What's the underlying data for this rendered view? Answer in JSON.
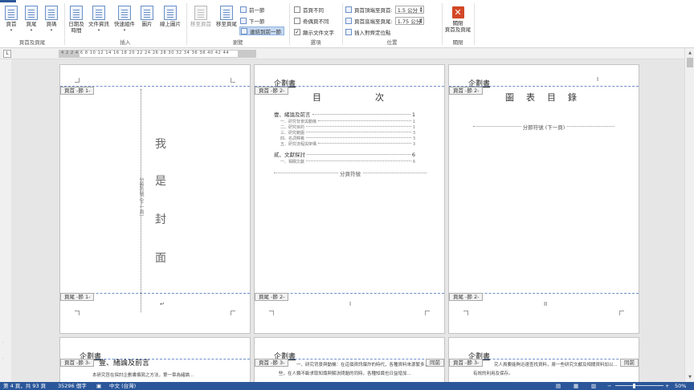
{
  "ribbon": {
    "group_header_footer": {
      "label": "頁首及頁尾",
      "header": "頁首",
      "footer": "頁尾",
      "page_number": "頁碼"
    },
    "group_insert": {
      "label": "插入",
      "date_time": "日期及\n時間",
      "doc_info": "文件資訊",
      "quick_parts": "快速組件",
      "picture": "圖片",
      "online_picture": "線上圖片"
    },
    "group_navigation": {
      "label": "瀏覽",
      "goto_header": "移至頁首",
      "goto_footer": "移至頁尾",
      "previous": "前一節",
      "next": "下一節",
      "link_to_previous": "連結到前一節"
    },
    "group_options": {
      "label": "選項",
      "different_first_page": "首頁不同",
      "different_odd_even": "奇偶頁不同",
      "show_document_text": "顯示文件文字"
    },
    "group_position": {
      "label": "位置",
      "header_from_top_label": "頁首頂端至頁首:",
      "header_from_top_value": "1.5 公分",
      "footer_from_bottom_label": "頁首底端至頁尾:",
      "footer_from_bottom_value": "1.75 公分",
      "insert_alignment_tab": "插入對齊定位點"
    },
    "group_close": {
      "label": "關閉",
      "close_button": "關閉\n頁首及頁尾"
    }
  },
  "ruler": {
    "corner": "L",
    "numbers": "4  2  2  4  6  8  10 12 14 16 18 20 22 24 26 28 30 32 34 36 38 40 42 44"
  },
  "pages": {
    "p1": {
      "header_tag": "頁首 -節 1-",
      "footer_tag": "頁尾 -節 1-",
      "cover_chars": [
        "我",
        "是",
        "封",
        "面"
      ],
      "vertical_label": "分節符號 (下一頁)"
    },
    "p2": {
      "header_text": "企劃書",
      "header_tag": "頁首 -節 2-",
      "footer_tag": "頁尾 -節 2-",
      "title_left": "目",
      "title_right": "次",
      "toc": [
        {
          "label": "壹、緒論及前言",
          "num": "1",
          "sub": false
        },
        {
          "label": "一、研究背景與動機",
          "num": "1",
          "sub": true
        },
        {
          "label": "二、研究目的",
          "num": "1",
          "sub": true
        },
        {
          "label": "三、研究範圍",
          "num": "3",
          "sub": true
        },
        {
          "label": "四、名詞釋義",
          "num": "3",
          "sub": true
        },
        {
          "label": "五、研究流程與架構",
          "num": "3",
          "sub": true
        },
        {
          "label": "貳、文獻探討",
          "num": "6",
          "sub": false
        },
        {
          "label": "一、相關文獻",
          "num": "6",
          "sub": true
        }
      ],
      "section_break": "分頁符號",
      "footer_page_num": "I"
    },
    "p3": {
      "header_text": "企劃書",
      "header_tag": "頁首 -節 2-",
      "footer_tag": "頁尾 -節 2-",
      "title": "圖　表　目　錄",
      "section_break": "分節符號 (下一頁)",
      "footer_page_num": "II"
    },
    "p4": {
      "header_text": "企劃書",
      "header_tag": "頁首 -節 3-",
      "heading": "壹、緒論及前言",
      "body": "本研究旨在探討企劃書撰寫之方法，第一章為緒論..."
    },
    "p5": {
      "header_text": "企劃書",
      "header_tag": "頁首 -節 3-",
      "same_as_prev": "同前",
      "body1": "一、研究背景與動機：在這個資訊爆炸的時代，各種資料來源繁多...",
      "body2": "些，在人類不斷求取知識與解決問題的同時，各種知識也日益增加..."
    },
    "p6": {
      "header_text": "企劃書",
      "header_tag": "頁首 -節 3-",
      "same_as_prev": "同前",
      "body1": "究人員要能夠迅速查找資料，將一些研究文獻及相關資料加以...",
      "body2": "有效的利用及保存。"
    }
  },
  "statusbar": {
    "page": "第 4 頁，共 93 頁",
    "words": "35296 個字",
    "language": "中文 (台灣)",
    "zoom": "50%"
  },
  "colors": {
    "accent": "#2b579a",
    "close_red": "#d24726",
    "header_line": "#6d8fcb"
  }
}
